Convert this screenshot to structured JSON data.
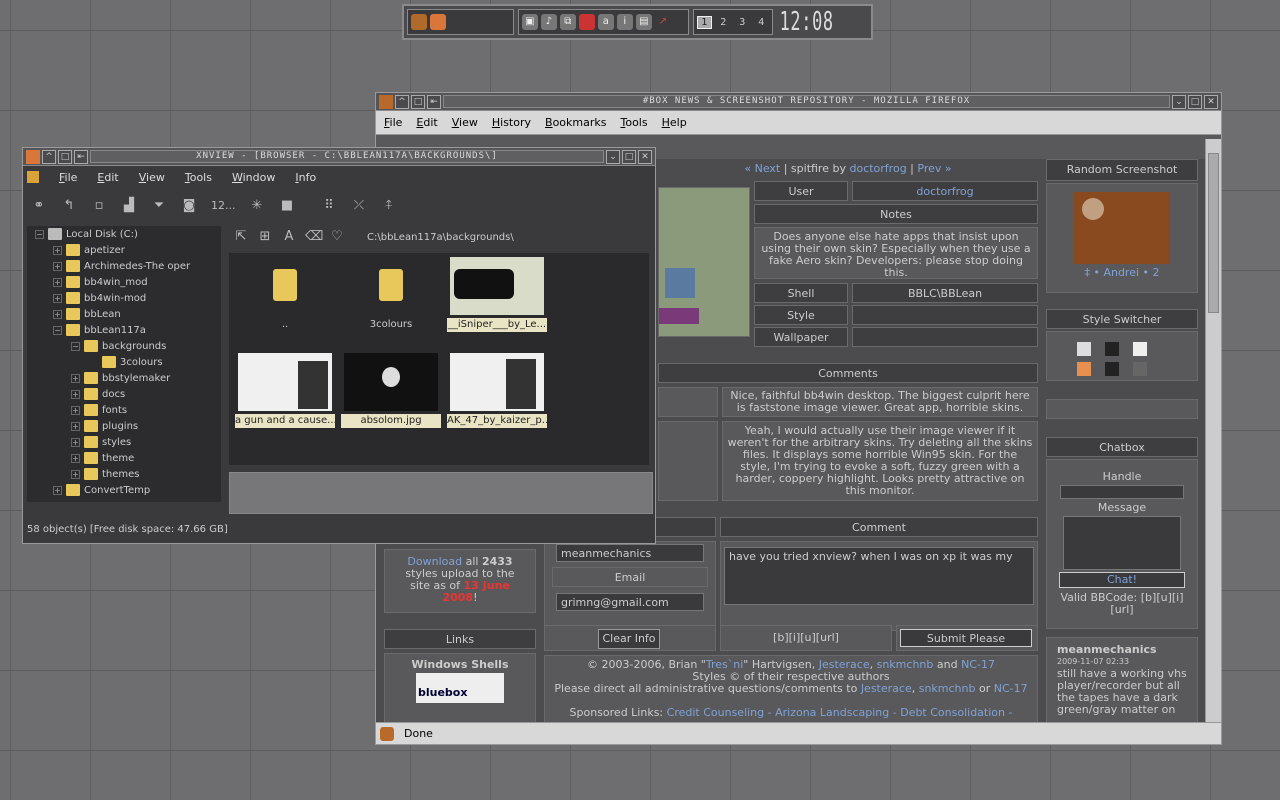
{
  "toolbar": {
    "workspaces": [
      "1",
      "2",
      "3",
      "4"
    ],
    "clock": "12:08"
  },
  "firefox": {
    "title": "#BOX NEWS & SCREENSHOT REPOSITORY - MOZILLA FIREFOX",
    "menu": [
      "File",
      "Edit",
      "View",
      "History",
      "Bookmarks",
      "Tools",
      "Help"
    ],
    "status": "Done",
    "nav": {
      "next": "« Next",
      "sep": " | ",
      "name": "spitfire",
      "by": " by ",
      "author": "doctorfrog",
      "prev": "Prev »"
    },
    "user_label": "User",
    "user_value": "doctorfrog",
    "notes_label": "Notes",
    "notes": "Does anyone else hate apps that insist upon using their own skin? Especially when they use a fake Aero skin? Developers: please stop doing this.",
    "shell_label": "Shell",
    "shell_value": "BBLC\\BBLean",
    "style_label": "Style",
    "wallpaper_label": "Wallpaper",
    "comments_label": "Comments",
    "comment1": "Nice, faithful bb4win desktop. The biggest culprit here is faststone image viewer. Great app, horrible skins.",
    "comment2": "Yeah, I would actually use their image viewer if it weren't for the arbitrary skins. Try deleting all the skins files. It displays some horrible Win95 skin. For the style, I'm trying to evoke a soft, fuzzy green with a harder, coppery highlight. Looks pretty attractive on this monitor.",
    "comment_label": "Comment",
    "name_value": "meanmechanics",
    "email_label": "Email",
    "email_value": "grimng@gmail.com",
    "comment_text": "have you tried xnview? when I was on xp it was my",
    "clear_button": "Clear Info",
    "bbcode": "[b][i][u][url]",
    "submit_button": "Submit Please",
    "download": {
      "link": "Download",
      "a": " all ",
      "count": "2433",
      "b": " styles upload to the site as of ",
      "date": "13 June 2008",
      "c": "!"
    },
    "links_label": "Links",
    "shells_label": "Windows Shells",
    "bluebox": "bluebox",
    "footer1a": "© 2003-2006, Brian \"",
    "footer1b": "Tres`ni",
    "footer1c": "\" Hartvigsen, ",
    "footer1d": "Jesterace",
    "footer1e": ", ",
    "footer1f": "snkmchnb",
    "footer1g": " and ",
    "footer1h": "NC-17",
    "footer2": "Styles © of their respective authors",
    "footer3": "Please direct all administrative questions/comments to ",
    "footer3b": "Jesterace",
    "footer3c": ", ",
    "footer3d": "snkmchnb",
    "footer3e": " or ",
    "footer3f": "NC-17",
    "footer4": "Sponsored Links: ",
    "sponsors": "Credit Counseling - Arizona Landscaping - Debt Consolidation -",
    "random_label": "Random Screenshot",
    "random_caption": "‡ • Andrei • 2",
    "style_switcher": "Style Switcher",
    "chatbox": "Chatbox",
    "handle": "Handle",
    "message": "Message",
    "chat_button": "Chat!",
    "valid_bbcode": "Valid BBCode: [b][u][i][url]",
    "chat_user": "meanmechanics",
    "chat_time": "2009-11-07 02:33",
    "chat_msg": "still have a working vhs player/recorder but all the tapes have a dark green/gray matter on"
  },
  "xnview": {
    "title": "XNVIEW - [BROWSER - C:\\BBLEAN117A\\BACKGROUNDS\\]",
    "menu": [
      "File",
      "Edit",
      "View",
      "Tools",
      "Window",
      "Info"
    ],
    "zoom": "12...",
    "path": "C:\\bbLean117a\\backgrounds\\",
    "tree": [
      {
        "label": "Local Disk (C:)",
        "indent": 0
      },
      {
        "label": "apetizer",
        "indent": 1
      },
      {
        "label": "Archimedes-The oper",
        "indent": 1
      },
      {
        "label": "bb4win_mod",
        "indent": 1
      },
      {
        "label": "bb4win-mod",
        "indent": 1
      },
      {
        "label": "bbLean",
        "indent": 1
      },
      {
        "label": "bbLean117a",
        "indent": 1
      },
      {
        "label": "backgrounds",
        "indent": 2
      },
      {
        "label": "3colours",
        "indent": 3
      },
      {
        "label": "bbstylemaker",
        "indent": 2
      },
      {
        "label": "docs",
        "indent": 2
      },
      {
        "label": "fonts",
        "indent": 2
      },
      {
        "label": "plugins",
        "indent": 2
      },
      {
        "label": "styles",
        "indent": 2
      },
      {
        "label": "theme",
        "indent": 2
      },
      {
        "label": "themes",
        "indent": 2
      },
      {
        "label": "ConvertTemp",
        "indent": 1
      }
    ],
    "thumbs": [
      "..",
      "3colours",
      "__iSniper___by_Le...",
      "a gun and a cause....",
      "absolom.jpg",
      "AK_47_by_kaizer_p..."
    ],
    "status": "58 object(s) [Free disk space: 47.66 GB]"
  }
}
